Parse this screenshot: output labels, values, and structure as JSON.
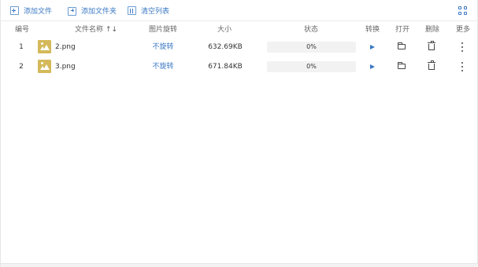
{
  "toolbar": {
    "add_file": {
      "label": "添加文件",
      "icon": "add-file-icon"
    },
    "add_folder": {
      "label": "添加文件夹",
      "icon": "add-folder-icon"
    },
    "clear_list": {
      "label": "清空列表",
      "icon": "clear-list-icon"
    },
    "view_toggle_icon": "grid-view-icon"
  },
  "table": {
    "headers": {
      "index": "编号",
      "filename": "文件名称",
      "rotation": "图片旋转",
      "size": "大小",
      "status": "状态",
      "convert": "转换",
      "open": "打开",
      "delete": "删除",
      "more": "更多"
    },
    "sort_icon": "↑↓",
    "rows": [
      {
        "index": "1",
        "filename": "2.png",
        "rotation": "不旋转",
        "size": "632.69KB",
        "progress_text": "0%",
        "progress": 0
      },
      {
        "index": "2",
        "filename": "3.png",
        "rotation": "不旋转",
        "size": "671.84KB",
        "progress_text": "0%",
        "progress": 0
      }
    ]
  },
  "colors": {
    "accent": "#3a78c3",
    "thumbnail": "#d4b95a",
    "progress_track": "#f2f2f2"
  }
}
